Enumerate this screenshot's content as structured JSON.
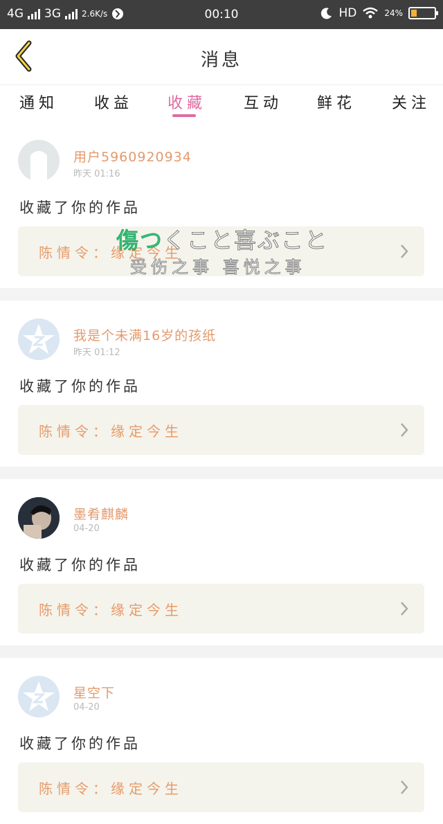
{
  "status_bar": {
    "network1": "4G",
    "network2": "3G",
    "speed": "2.6K/s",
    "time": "00:10",
    "hd": "HD",
    "battery_percent": "24%",
    "battery_level": 0.24
  },
  "header": {
    "title": "消息"
  },
  "tabs": [
    {
      "label": "通知"
    },
    {
      "label": "收益"
    },
    {
      "label": "收藏",
      "active": true
    },
    {
      "label": "互动"
    },
    {
      "label": "鲜花"
    },
    {
      "label": "关注"
    }
  ],
  "messages": [
    {
      "username": "用户5960920934",
      "time": "昨天 01:16",
      "action": "收藏了你的作品",
      "work": "陈情令：缘定今生",
      "avatar": "default-user"
    },
    {
      "username": "我是个未满16岁的孩纸",
      "time": "昨天 01:12",
      "action": "收藏了你的作品",
      "work": "陈情令：缘定今生",
      "avatar": "qq-default"
    },
    {
      "username": "墨肴麒麟",
      "time": "04-20",
      "action": "收藏了你的作品",
      "work": "陈情令：缘定今生",
      "avatar": "photo"
    },
    {
      "username": "星空下",
      "time": "04-20",
      "action": "收藏了你的作品",
      "work": "陈情令：缘定今生",
      "avatar": "qq-default"
    }
  ],
  "overlay": {
    "line1_green": "傷つ",
    "line1_rest": "くこと喜ぶこと",
    "line2": "受伤之事 喜悦之事"
  },
  "colors": {
    "accent": "#e06aa0",
    "username": "#e39a6d",
    "work_bg": "#f4f4ec"
  }
}
